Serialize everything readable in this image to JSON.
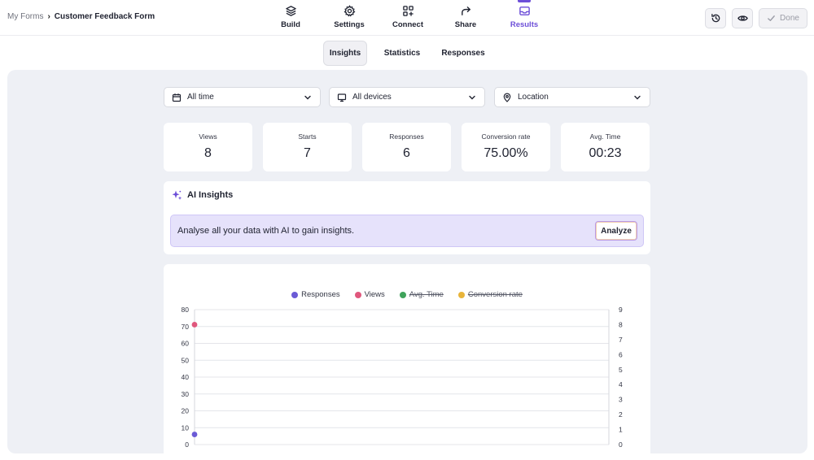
{
  "breadcrumb": {
    "root": "My Forms",
    "separator": "›",
    "current": "Customer Feedback Form"
  },
  "nav": [
    {
      "label": "Build",
      "icon": "layers-icon"
    },
    {
      "label": "Settings",
      "icon": "gear-icon"
    },
    {
      "label": "Connect",
      "icon": "connect-grid-icon"
    },
    {
      "label": "Share",
      "icon": "share-arrow-icon"
    },
    {
      "label": "Results",
      "icon": "inbox-tray-icon",
      "active": true
    }
  ],
  "actions": {
    "history_icon": "history-icon",
    "preview_icon": "eye-icon",
    "done_label": "Done"
  },
  "subtabs": [
    {
      "label": "Insights",
      "active": true
    },
    {
      "label": "Statistics"
    },
    {
      "label": "Responses"
    }
  ],
  "filters": {
    "time": "All time",
    "devices": "All devices",
    "location": "Location"
  },
  "stats": [
    {
      "label": "Views",
      "value": "8"
    },
    {
      "label": "Starts",
      "value": "7"
    },
    {
      "label": "Responses",
      "value": "6"
    },
    {
      "label": "Conversion rate",
      "value": "75.00%"
    },
    {
      "label": "Avg. Time",
      "value": "00:23"
    }
  ],
  "ai": {
    "title": "AI Insights",
    "banner_text": "Analyse all your data with AI to gain insights.",
    "button_label": "Analyze"
  },
  "colors": {
    "accent": "#6d4fd8",
    "responses": "#6b5bd6",
    "views": "#e0577d",
    "avg_time": "#3fa35b",
    "conversion_rate": "#e8b43a"
  },
  "chart_data": {
    "type": "line",
    "legend": [
      {
        "name": "Responses",
        "color": "#6b5bd6",
        "enabled": true
      },
      {
        "name": "Views",
        "color": "#e0577d",
        "enabled": true
      },
      {
        "name": "Avg. Time",
        "color": "#3fa35b",
        "enabled": false
      },
      {
        "name": "Conversion rate",
        "color": "#e8b43a",
        "enabled": false
      }
    ],
    "y_left_ticks": [
      "80",
      "70",
      "60",
      "50",
      "40",
      "30",
      "20",
      "10",
      "0"
    ],
    "y_right_ticks": [
      "9",
      "8",
      "7",
      "6",
      "5",
      "4",
      "3",
      "2",
      "1",
      "0"
    ],
    "y_left_range": [
      0,
      80
    ],
    "y_right_range": [
      0,
      9
    ],
    "series": [
      {
        "name": "Views",
        "axis": "right",
        "values": [
          8
        ]
      },
      {
        "name": "Responses",
        "axis": "left",
        "values": [
          6
        ]
      }
    ],
    "grid": true
  }
}
